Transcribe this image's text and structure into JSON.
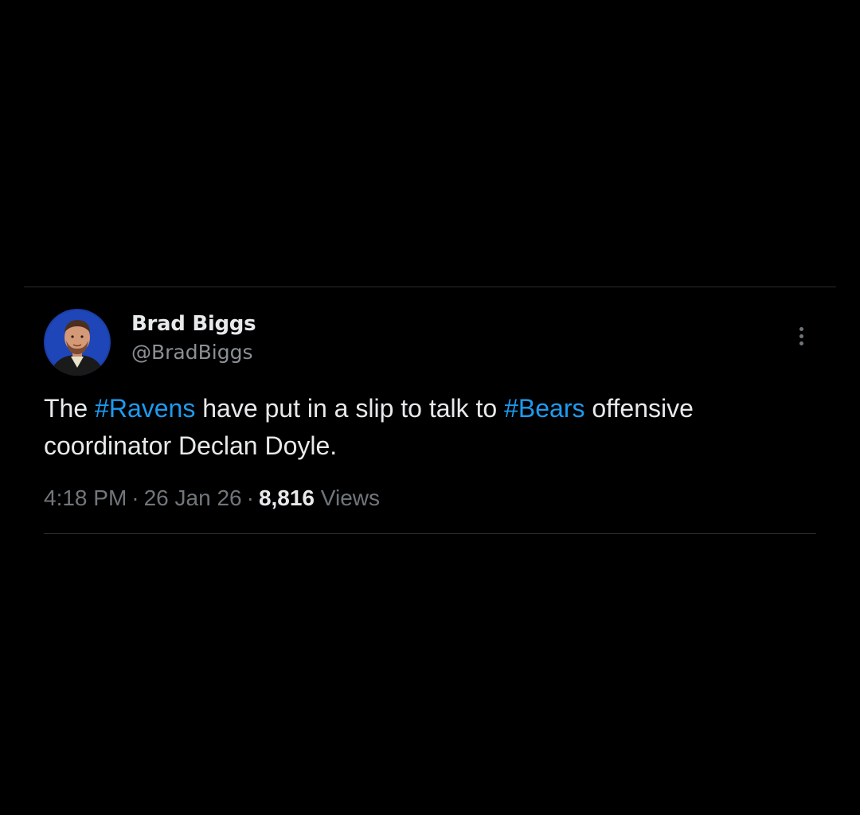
{
  "tweet": {
    "author": {
      "display_name": "Brad Biggs",
      "handle": "@BradBiggs"
    },
    "text": {
      "part1": "The ",
      "hashtag1": "#Ravens",
      "part2": " have put in a slip to talk to ",
      "hashtag2": "#Bears",
      "part3": " offensive coordinator Declan Doyle."
    },
    "meta": {
      "time": "4:18 PM",
      "date": "26 Jan 26",
      "separator": "·",
      "views_count": "8,816",
      "views_label": "Views"
    }
  },
  "icons": {
    "more": "more-vertical-icon",
    "avatar": "profile-photo"
  },
  "colors": {
    "background": "#000000",
    "text": "#e7e9ea",
    "muted": "#71767b",
    "link": "#1d9bf0",
    "divider": "#2a2d30"
  }
}
